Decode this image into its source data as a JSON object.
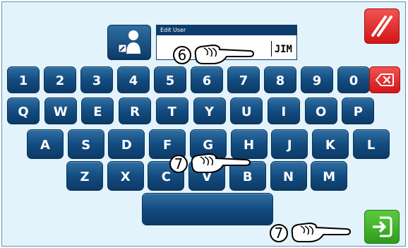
{
  "edit_field": {
    "title": "Edit User",
    "value": "JIM"
  },
  "icons": {
    "user": "user-edit-icon",
    "clear": "clear-icon",
    "backspace": "backspace-icon",
    "enter": "enter-arrow-icon",
    "hand": "pointing-hand-icon"
  },
  "keyboard": {
    "row1": [
      "1",
      "2",
      "3",
      "4",
      "5",
      "6",
      "7",
      "8",
      "9",
      "0"
    ],
    "row2": [
      "Q",
      "W",
      "E",
      "R",
      "T",
      "Y",
      "U",
      "I",
      "O",
      "P"
    ],
    "row3": [
      "A",
      "S",
      "D",
      "F",
      "G",
      "H",
      "J",
      "K",
      "L"
    ],
    "row4": [
      "Z",
      "X",
      "C",
      "V",
      "B",
      "N",
      "M"
    ]
  },
  "annotations": [
    "6",
    "7",
    "7"
  ],
  "colors": {
    "key_blue": "#134c80",
    "clear_red": "#e02b2b",
    "enter_green": "#3fae26",
    "background": "#e3f3fb"
  }
}
